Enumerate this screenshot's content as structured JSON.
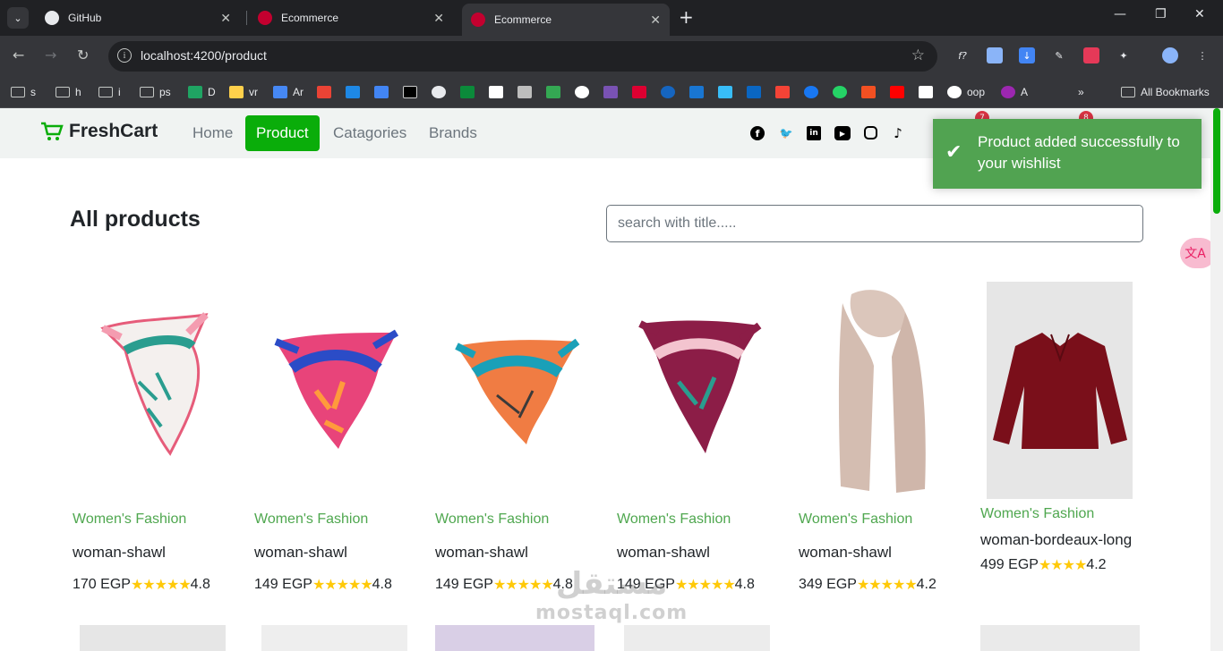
{
  "browser": {
    "tabs": [
      {
        "title": "GitHub"
      },
      {
        "title": "Ecommerce"
      },
      {
        "title": "Ecommerce"
      }
    ],
    "url": "localhost:4200/product",
    "bookmarks": [
      "s",
      "h",
      "i",
      "ps",
      "D",
      "vr",
      "Ar",
      "oop",
      "A"
    ],
    "all_bookmarks": "All Bookmarks"
  },
  "site": {
    "brand": "FreshCart",
    "nav": [
      "Home",
      "Product",
      "Catagories",
      "Brands"
    ],
    "active_nav": "Product",
    "cart_count": "7",
    "wishlist_count": "8"
  },
  "toast": {
    "message": "Product added successfully to your wishlist"
  },
  "main": {
    "heading": "All products",
    "search_placeholder": "search with title....."
  },
  "products": [
    {
      "category": "Women's Fashion",
      "title": "woman-shawl",
      "price": "170 EGP",
      "rating": "4.8"
    },
    {
      "category": "Women's Fashion",
      "title": "woman-shawl",
      "price": "149 EGP",
      "rating": "4.8"
    },
    {
      "category": "Women's Fashion",
      "title": "woman-shawl",
      "price": "149 EGP",
      "rating": "4.8"
    },
    {
      "category": "Women's Fashion",
      "title": "woman-shawl",
      "price": "149 EGP",
      "rating": "4.8"
    },
    {
      "category": "Women's Fashion",
      "title": "woman-shawl",
      "price": "349 EGP",
      "rating": "4.2"
    },
    {
      "category": "Women's Fashion",
      "title": "woman-bordeaux-long",
      "price": "499 EGP",
      "rating": "4.2"
    }
  ],
  "watermark": {
    "arabic": "مستقل",
    "latin": "mostaql.com"
  },
  "colors": {
    "accent": "#0aad0a",
    "category": "#4fa74f",
    "toast": "#51a351",
    "star": "#ffc908"
  }
}
